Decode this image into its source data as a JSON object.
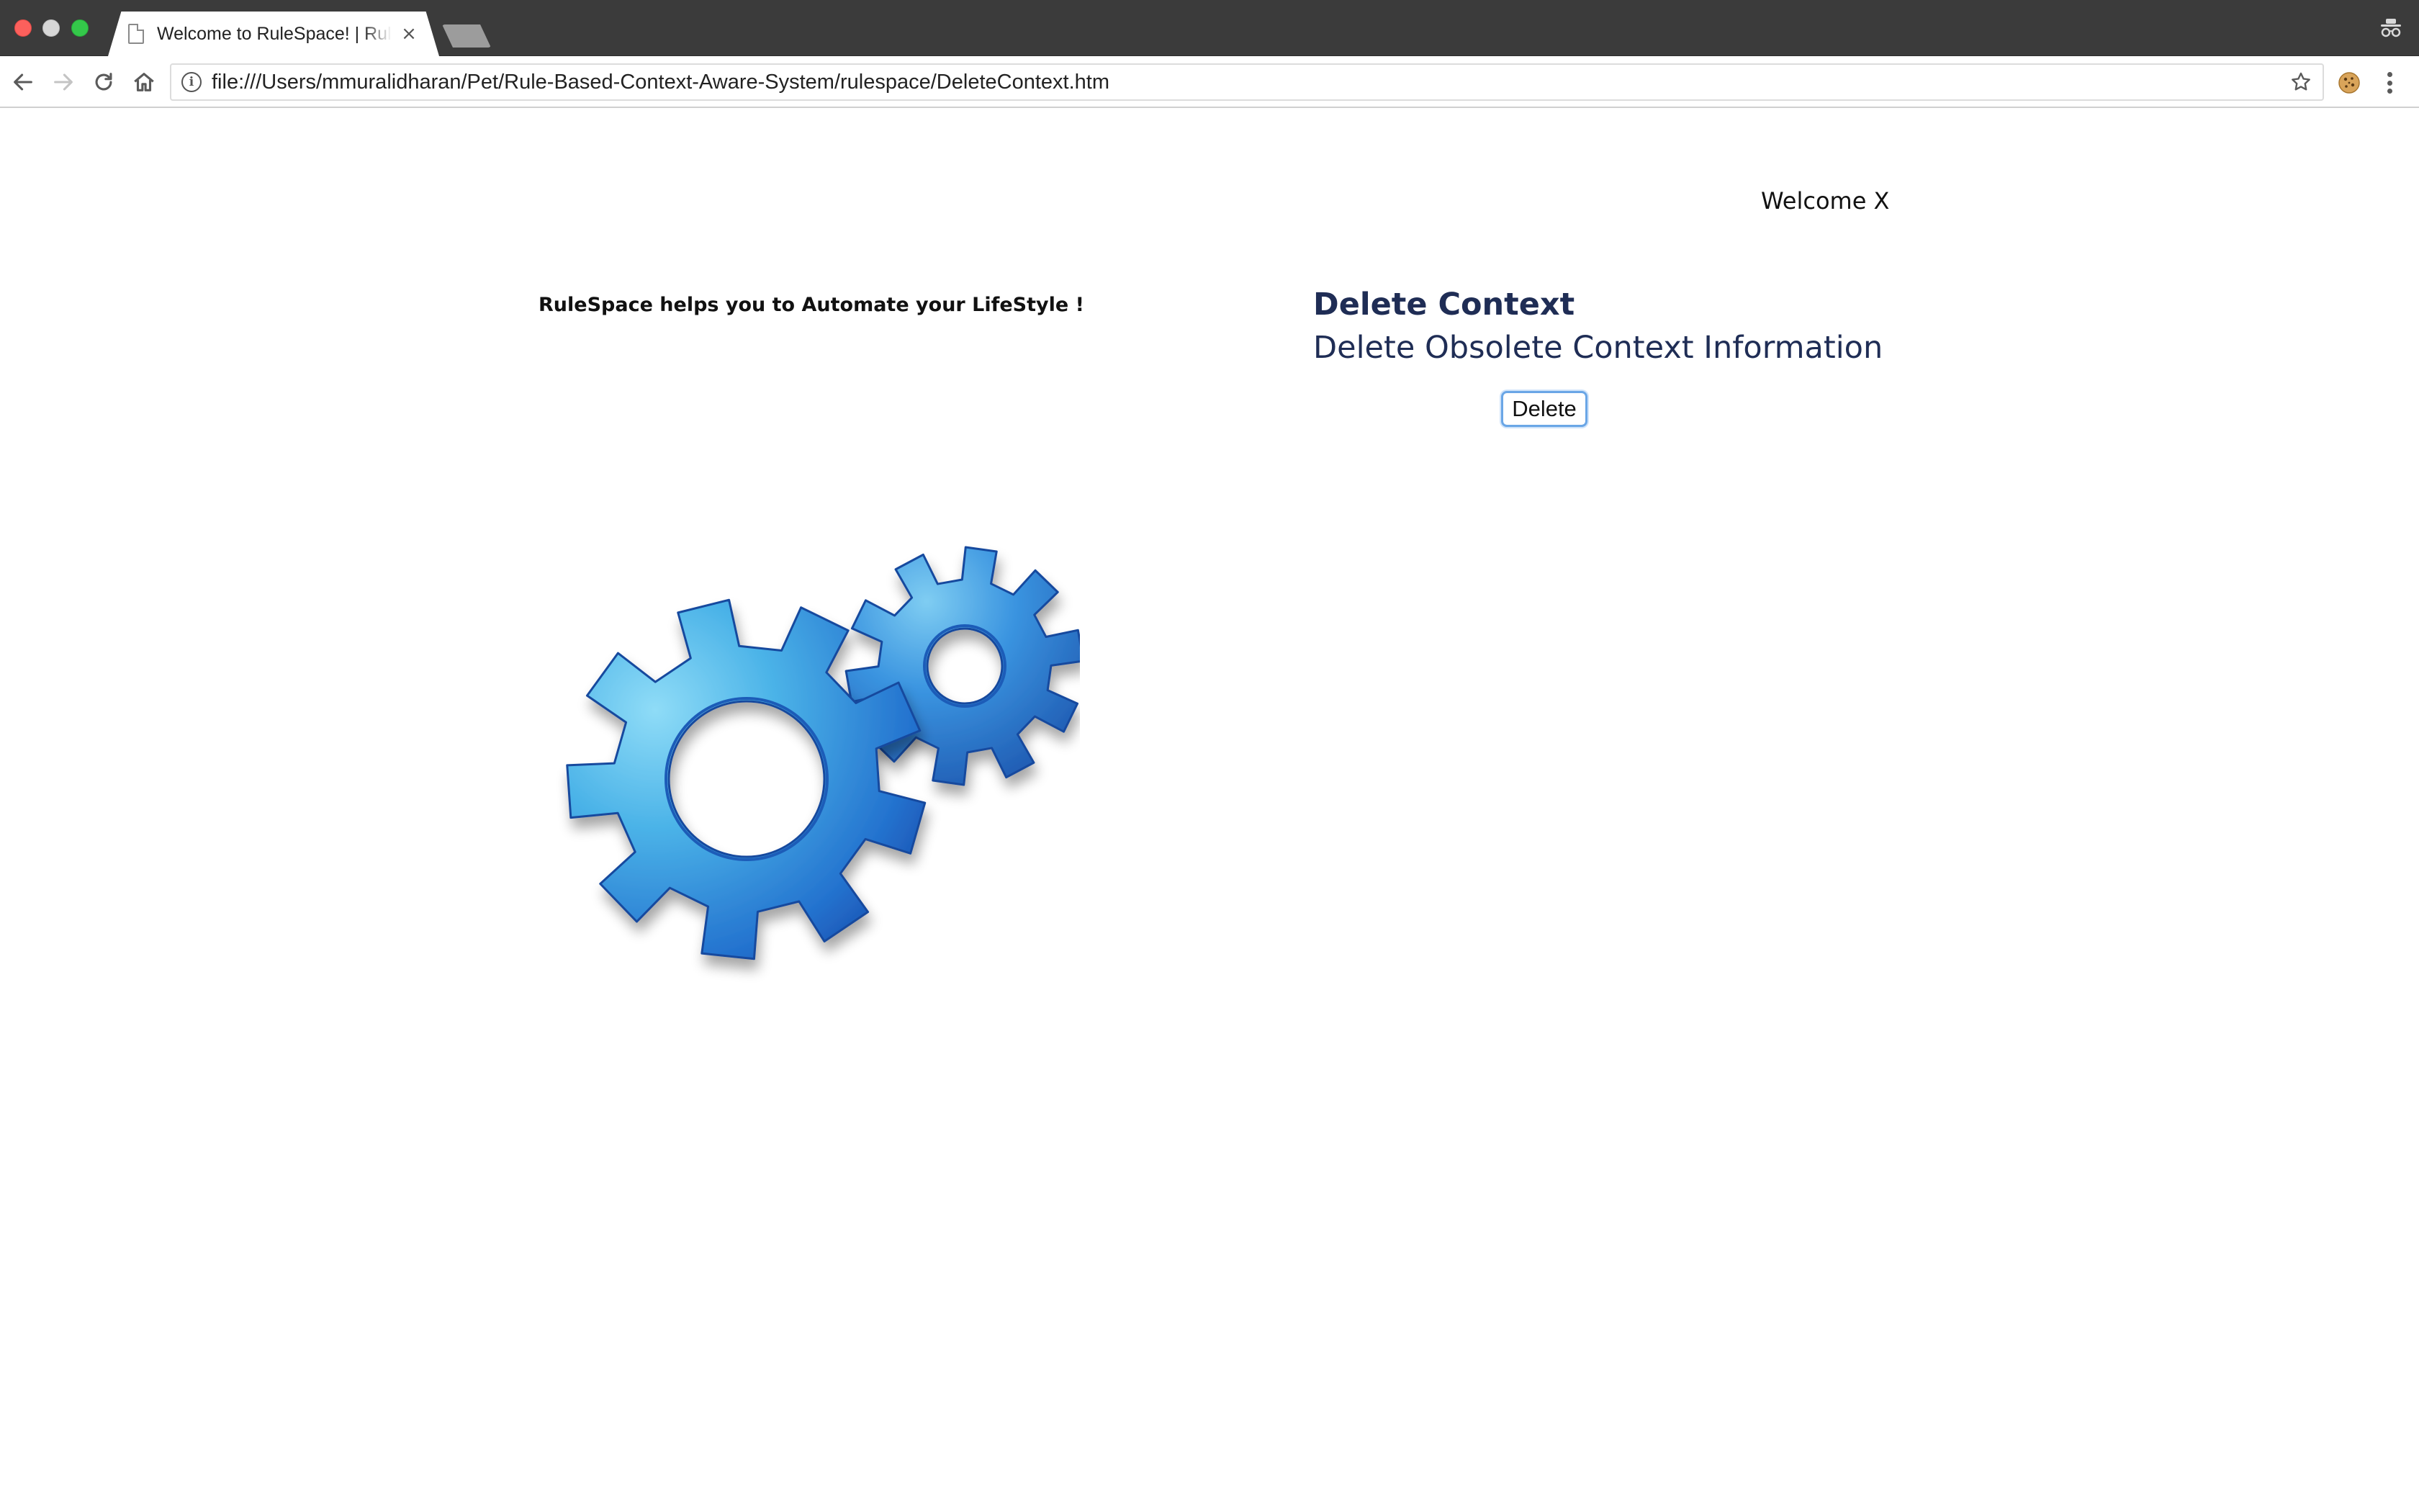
{
  "browser": {
    "tab_title": "Welcome to RuleSpace! | RuleSpace",
    "tab_close_glyph": "×",
    "url": "file:///Users/mmuralidharan/Pet/Rule-Based-Context-Aware-System/rulespace/DeleteContext.htm",
    "info_glyph": "i",
    "icons": [
      "back-arrow-icon",
      "forward-arrow-icon",
      "reload-icon",
      "home-icon",
      "info-icon",
      "bookmark-star-icon",
      "cookie-extension-icon",
      "more-menu-icon",
      "incognito-icon",
      "page-icon"
    ]
  },
  "header": {
    "welcome_text": "Welcome X"
  },
  "hero": {
    "tagline": "RuleSpace helps you to Automate your LifeStyle !",
    "image": "blue-gears-icon"
  },
  "main": {
    "title": "Delete Context",
    "subtitle": "Delete Obsolete Context Information",
    "delete_button_label": "Delete"
  },
  "colors": {
    "heading": "#1f2d55",
    "titlebar": "#3b3b3b",
    "gear_light": "#5bc0ec",
    "gear_dark": "#1a56b8",
    "button_focus": "#6aa6e6"
  }
}
